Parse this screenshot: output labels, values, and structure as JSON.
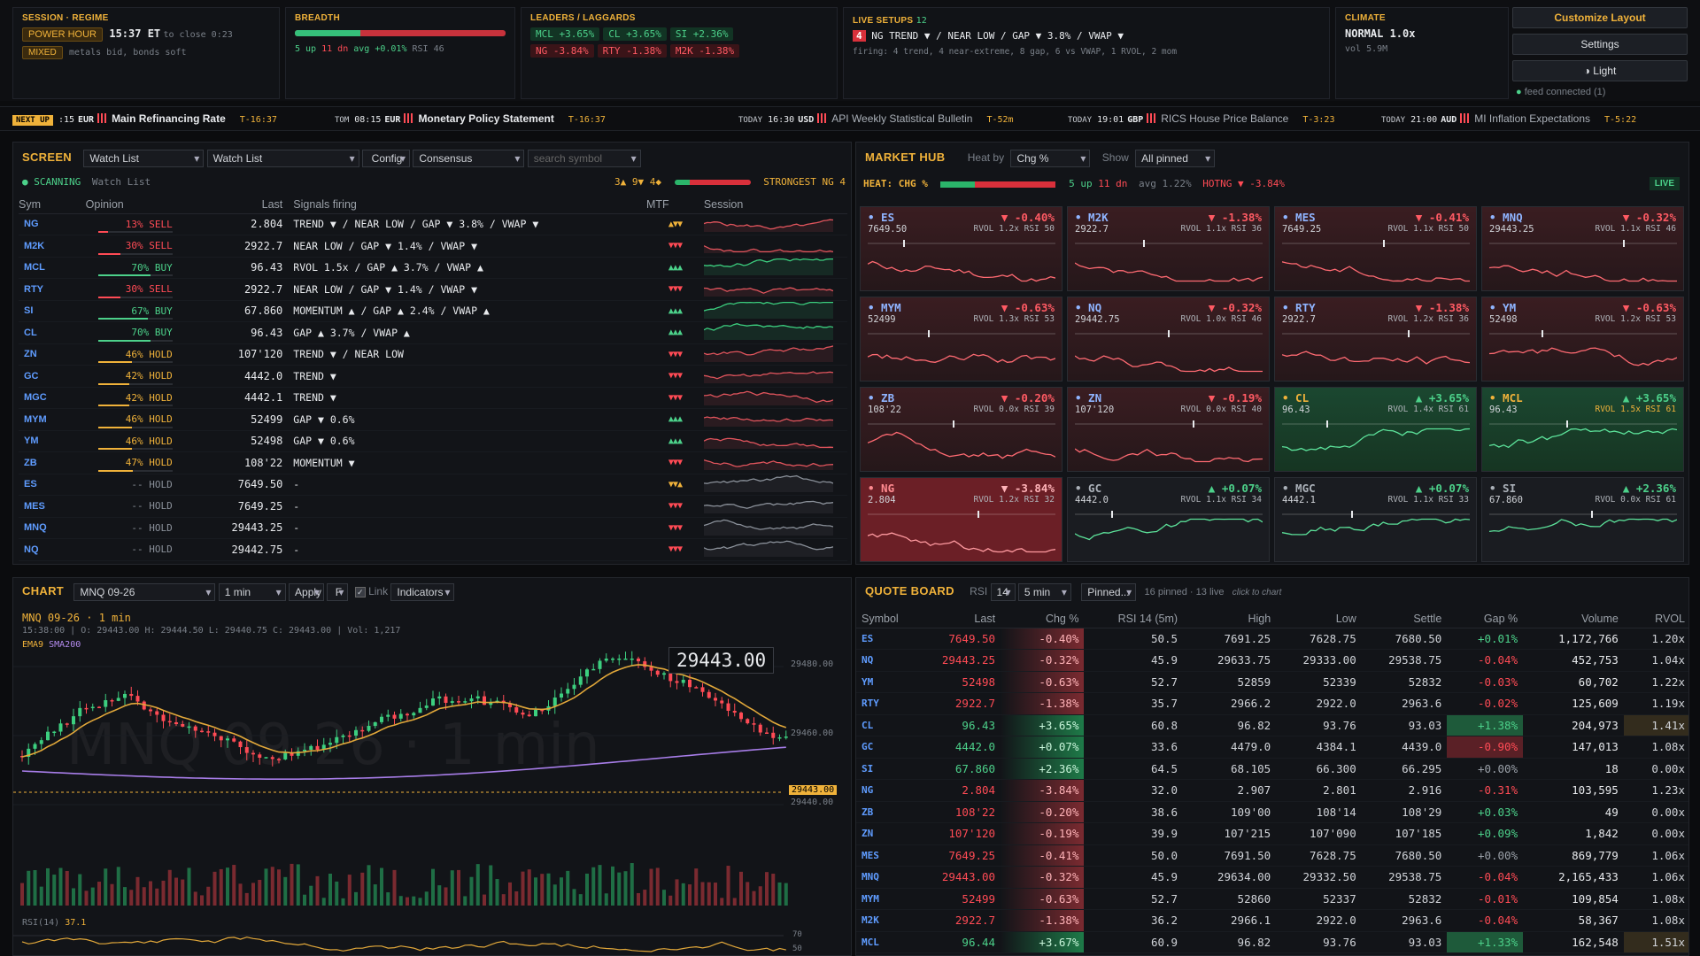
{
  "session": {
    "label": "SESSION · REGIME",
    "badge": "POWER HOUR",
    "time": "15:37 ET",
    "close": "to close 0:23",
    "mixed": "MIXED",
    "note": "metals bid, bonds soft"
  },
  "breadth": {
    "label": "BREADTH",
    "up": "5 up",
    "dn": "11 dn",
    "avg": "avg +0.01%",
    "rsi": "RSI 46",
    "up_frac": 0.3125
  },
  "leaders": {
    "label": "LEADERS / LAGGARDS",
    "row1": [
      "MCL +3.65%",
      "CL +3.65%",
      "SI +2.36%"
    ],
    "row2": [
      "NG -3.84%",
      "RTY -1.38%",
      "M2K -1.38%"
    ]
  },
  "setups": {
    "label": "LIVE SETUPS",
    "count": "12",
    "badge": "4",
    "line": "NG  TREND ▼  /  NEAR LOW  /  GAP ▼ 3.8%  /  VWAP ▼",
    "sub": "firing: 4 trend, 4 near-extreme, 8 gap, 6 vs VWAP, 1 RVOL, 2 mom"
  },
  "climate": {
    "label": "CLIMATE",
    "value": "NORMAL 1.0x",
    "vol": "vol 5.9M"
  },
  "buttons": {
    "customize": "Customize Layout",
    "settings": "Settings",
    "light": "◑ Light",
    "feed": "feed connected (1)"
  },
  "ticker": [
    {
      "pre": "NEXT UP",
      "t": ":15",
      "cur": "EUR",
      "name": "Main Refinancing Rate",
      "cd": "T-16:37"
    },
    {
      "pre": "TOM",
      "t": "08:15",
      "cur": "EUR",
      "name": "Monetary Policy Statement",
      "cd": "T-16:37"
    },
    {
      "pre": "TODAY",
      "t": "16:30",
      "cur": "USD",
      "name": "API Weekly Statistical Bulletin",
      "cd": "T-52m"
    },
    {
      "pre": "TODAY",
      "t": "19:01",
      "cur": "GBP",
      "name": "RICS House Price Balance",
      "cd": "T-3:23"
    },
    {
      "pre": "TODAY",
      "t": "21:00",
      "cur": "AUD",
      "name": "MI Inflation Expectations",
      "cd": "T-5:22"
    }
  ],
  "screen": {
    "title": "SCREEN",
    "sel1": "Watch List",
    "sel2": "Watch List",
    "config": "Config",
    "consensus": "Consensus",
    "search_ph": "search symbol",
    "scanning": "SCANNING",
    "list": "Watch List",
    "counts": "3▲ 9▼ 4◆",
    "strongest": "STRONGEST NG 4",
    "headers": [
      "Sym",
      "Opinion",
      "Last",
      "Signals firing",
      "MTF",
      "Session"
    ],
    "rows": [
      {
        "sym": "NG",
        "op": "13% SELL",
        "last": "2.804",
        "sig": "TREND ▼  /  NEAR LOW  /  GAP ▼ 3.8%  /  VWAP ▼",
        "mtf": "▲▼▼",
        "t": "d"
      },
      {
        "sym": "M2K",
        "op": "30% SELL",
        "last": "2922.7",
        "sig": "NEAR LOW  /  GAP ▼ 1.4%  /  VWAP ▼",
        "mtf": "▼▼▼",
        "t": "d"
      },
      {
        "sym": "MCL",
        "op": "70% BUY",
        "last": "96.43",
        "sig": "RVOL 1.5x  /  GAP ▲ 3.7%  /  VWAP ▲",
        "mtf": "▲▲▲",
        "t": "u"
      },
      {
        "sym": "RTY",
        "op": "30% SELL",
        "last": "2922.7",
        "sig": "NEAR LOW  /  GAP ▼ 1.4%  /  VWAP ▼",
        "mtf": "▼▼▼",
        "t": "d"
      },
      {
        "sym": "SI",
        "op": "67% BUY",
        "last": "67.860",
        "sig": "MOMENTUM ▲  /  GAP ▲ 2.4%  /  VWAP ▲",
        "mtf": "▲▲▲",
        "t": "u"
      },
      {
        "sym": "CL",
        "op": "70% BUY",
        "last": "96.43",
        "sig": "GAP ▲ 3.7%  /  VWAP ▲",
        "mtf": "▲▲▲",
        "t": "u"
      },
      {
        "sym": "ZN",
        "op": "46% HOLD",
        "last": "107'120",
        "sig": "TREND ▼  /  NEAR LOW",
        "mtf": "▼▼▼",
        "t": "h"
      },
      {
        "sym": "GC",
        "op": "42% HOLD",
        "last": "4442.0",
        "sig": "TREND ▼",
        "mtf": "▼▼▼",
        "t": "h"
      },
      {
        "sym": "MGC",
        "op": "42% HOLD",
        "last": "4442.1",
        "sig": "TREND ▼",
        "mtf": "▼▼▼",
        "t": "h"
      },
      {
        "sym": "MYM",
        "op": "46% HOLD",
        "last": "52499",
        "sig": "GAP ▼ 0.6%",
        "mtf": "▲▲▲",
        "t": "h"
      },
      {
        "sym": "YM",
        "op": "46% HOLD",
        "last": "52498",
        "sig": "GAP ▼ 0.6%",
        "mtf": "▲▲▲",
        "t": "h"
      },
      {
        "sym": "ZB",
        "op": "47% HOLD",
        "last": "108'22",
        "sig": "MOMENTUM ▼",
        "mtf": "▼▼▼",
        "t": "h"
      },
      {
        "sym": "ES",
        "op": "-- HOLD",
        "last": "7649.50",
        "sig": "-",
        "mtf": "▼▼▲",
        "t": "n"
      },
      {
        "sym": "MES",
        "op": "-- HOLD",
        "last": "7649.25",
        "sig": "-",
        "mtf": "▼▼▼",
        "t": "n"
      },
      {
        "sym": "MNQ",
        "op": "-- HOLD",
        "last": "29443.25",
        "sig": "-",
        "mtf": "▼▼▼",
        "t": "n"
      },
      {
        "sym": "NQ",
        "op": "-- HOLD",
        "last": "29442.75",
        "sig": "-",
        "mtf": "▼▼▼",
        "t": "n"
      }
    ]
  },
  "hub": {
    "title": "MARKET HUB",
    "heat_by": "Heat by",
    "heat_sel": "Chg %",
    "show": "Show",
    "show_sel": "All pinned",
    "heat_label": "HEAT: CHG %",
    "up": "5 up",
    "dn": "11 dn",
    "avg": "avg 1.22%",
    "hot": "HOTNG ▼ -3.84%",
    "live": "LIVE",
    "tiles": [
      {
        "sym": "ES",
        "chg": "▼ -0.40%",
        "last": "7649.50",
        "meta": "RVOL 1.2x RSI 50",
        "c": "r"
      },
      {
        "sym": "M2K",
        "chg": "▼ -1.38%",
        "last": "2922.7",
        "meta": "RVOL 1.1x RSI 36",
        "c": "r"
      },
      {
        "sym": "MES",
        "chg": "▼ -0.41%",
        "last": "7649.25",
        "meta": "RVOL 1.1x RSI 50",
        "c": "r"
      },
      {
        "sym": "MNQ",
        "chg": "▼ -0.32%",
        "last": "29443.25",
        "meta": "RVOL 1.1x RSI 46",
        "c": "r"
      },
      {
        "sym": "MYM",
        "chg": "▼ -0.63%",
        "last": "52499",
        "meta": "RVOL 1.3x RSI 53",
        "c": "r"
      },
      {
        "sym": "NQ",
        "chg": "▼ -0.32%",
        "last": "29442.75",
        "meta": "RVOL 1.0x RSI 46",
        "c": "r"
      },
      {
        "sym": "RTY",
        "chg": "▼ -1.38%",
        "last": "2922.7",
        "meta": "RVOL 1.2x RSI 36",
        "c": "r"
      },
      {
        "sym": "YM",
        "chg": "▼ -0.63%",
        "last": "52498",
        "meta": "RVOL 1.2x RSI 53",
        "c": "r"
      },
      {
        "sym": "ZB",
        "chg": "▼ -0.20%",
        "last": "108'22",
        "meta": "RVOL 0.0x RSI 39",
        "c": "r"
      },
      {
        "sym": "ZN",
        "chg": "▼ -0.19%",
        "last": "107'120",
        "meta": "RVOL 0.0x RSI 40",
        "c": "r"
      },
      {
        "sym": "CL",
        "chg": "▲ +3.65%",
        "last": "96.43",
        "meta": "RVOL 1.4x RSI 61",
        "c": "g"
      },
      {
        "sym": "MCL",
        "chg": "▲ +3.65%",
        "last": "96.43",
        "meta": "RVOL 1.5x RSI 61",
        "c": "g"
      },
      {
        "sym": "NG",
        "chg": "▼ -3.84%",
        "last": "2.804",
        "meta": "RVOL 1.2x RSI 32",
        "c": "R"
      },
      {
        "sym": "GC",
        "chg": "▲ +0.07%",
        "last": "4442.0",
        "meta": "RVOL 1.1x RSI 34",
        "c": "n"
      },
      {
        "sym": "MGC",
        "chg": "▲ +0.07%",
        "last": "4442.1",
        "meta": "RVOL 1.1x RSI 33",
        "c": "n"
      },
      {
        "sym": "SI",
        "chg": "▲ +2.36%",
        "last": "67.860",
        "meta": "RVOL 0.0x RSI 61",
        "c": "n"
      }
    ]
  },
  "chart": {
    "title": "CHART",
    "sym_sel": "MNQ 09-26",
    "tf_sel": "1 min",
    "apply": "Apply",
    "f": "F",
    "link": "Link",
    "indicators": "Indicators",
    "name": "MNQ 09-26 · 1 min",
    "ohlc": "15:38:00  |  O: 29443.00  H: 29444.50  L: 29440.75  C: 29443.00  |  Vol: 1,217",
    "ema": "EMA9",
    "sma": "SMA200",
    "price_box": "29443.00",
    "y1": "29480.00",
    "y2": "29460.00",
    "y3": "29440.00",
    "tag": "29443.00",
    "rsi": "RSI(14)",
    "rsi_v": "37.1",
    "r70": "70",
    "r50": "50",
    "watermark": "MNQ 09-26 · 1 min"
  },
  "qb": {
    "title": "QUOTE BOARD",
    "rsi_l": "RSI",
    "rsi_v": "14",
    "tf": "5 min",
    "pinned": "Pinned...",
    "info": "16 pinned · 13 live",
    "hint": "click to chart",
    "headers": [
      "Symbol",
      "Last",
      "Chg %",
      "RSI 14 (5m)",
      "High",
      "Low",
      "Settle",
      "Gap %",
      "Volume",
      "RVOL"
    ],
    "rows": [
      [
        "ES",
        "7649.50",
        "-0.40%",
        "50.5",
        "7691.25",
        "7628.75",
        "7680.50",
        "+0.01%",
        "1,172,766",
        "1.20x"
      ],
      [
        "NQ",
        "29443.25",
        "-0.32%",
        "45.9",
        "29633.75",
        "29333.00",
        "29538.75",
        "-0.04%",
        "452,753",
        "1.04x"
      ],
      [
        "YM",
        "52498",
        "-0.63%",
        "52.7",
        "52859",
        "52339",
        "52832",
        "-0.03%",
        "60,702",
        "1.22x"
      ],
      [
        "RTY",
        "2922.7",
        "-1.38%",
        "35.7",
        "2966.2",
        "2922.0",
        "2963.6",
        "-0.02%",
        "125,609",
        "1.19x"
      ],
      [
        "CL",
        "96.43",
        "+3.65%",
        "60.8",
        "96.82",
        "93.76",
        "93.03",
        "+1.38%",
        "204,973",
        "1.41x"
      ],
      [
        "GC",
        "4442.0",
        "+0.07%",
        "33.6",
        "4479.0",
        "4384.1",
        "4439.0",
        "-0.90%",
        "147,013",
        "1.08x"
      ],
      [
        "SI",
        "67.860",
        "+2.36%",
        "64.5",
        "68.105",
        "66.300",
        "66.295",
        "+0.00%",
        "18",
        "0.00x"
      ],
      [
        "NG",
        "2.804",
        "-3.84%",
        "32.0",
        "2.907",
        "2.801",
        "2.916",
        "-0.31%",
        "103,595",
        "1.23x"
      ],
      [
        "ZB",
        "108'22",
        "-0.20%",
        "38.6",
        "109'00",
        "108'14",
        "108'29",
        "+0.03%",
        "49",
        "0.00x"
      ],
      [
        "ZN",
        "107'120",
        "-0.19%",
        "39.9",
        "107'215",
        "107'090",
        "107'185",
        "+0.09%",
        "1,842",
        "0.00x"
      ],
      [
        "MES",
        "7649.25",
        "-0.41%",
        "50.0",
        "7691.50",
        "7628.75",
        "7680.50",
        "+0.00%",
        "869,779",
        "1.06x"
      ],
      [
        "MNQ",
        "29443.00",
        "-0.32%",
        "45.9",
        "29634.00",
        "29332.50",
        "29538.75",
        "-0.04%",
        "2,165,433",
        "1.06x"
      ],
      [
        "MYM",
        "52499",
        "-0.63%",
        "52.7",
        "52860",
        "52337",
        "52832",
        "-0.01%",
        "109,854",
        "1.08x"
      ],
      [
        "M2K",
        "2922.7",
        "-1.38%",
        "36.2",
        "2966.1",
        "2922.0",
        "2963.6",
        "-0.04%",
        "58,367",
        "1.08x"
      ],
      [
        "MCL",
        "96.44",
        "+3.67%",
        "60.9",
        "96.82",
        "93.76",
        "93.03",
        "+1.33%",
        "162,548",
        "1.51x"
      ]
    ]
  }
}
